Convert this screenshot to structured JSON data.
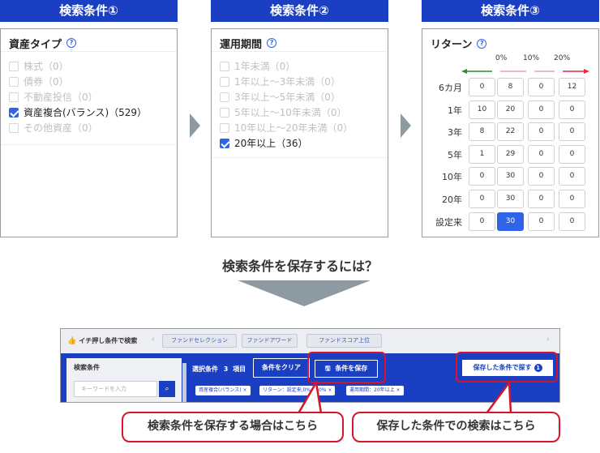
{
  "panels": {
    "p1": {
      "header": "検索条件①",
      "title": "資産タイプ",
      "items": [
        {
          "label": "株式（0）",
          "checked": false
        },
        {
          "label": "債券（0）",
          "checked": false
        },
        {
          "label": "不動産投信（0）",
          "checked": false
        },
        {
          "label": "資産複合(バランス)（529）",
          "checked": true
        },
        {
          "label": "その他資産（0）",
          "checked": false
        }
      ]
    },
    "p2": {
      "header": "検索条件②",
      "title": "運用期間",
      "items": [
        {
          "label": "1年未満（0）",
          "checked": false
        },
        {
          "label": "1年以上～3年未満（0）",
          "checked": false
        },
        {
          "label": "3年以上～5年未満（0）",
          "checked": false
        },
        {
          "label": "5年以上～10年未満（0）",
          "checked": false
        },
        {
          "label": "10年以上～20年未満（0）",
          "checked": false
        },
        {
          "label": "20年以上（36）",
          "checked": true
        }
      ]
    },
    "p3": {
      "header": "検索条件③",
      "title": "リターン",
      "axis": [
        "0%",
        "10%",
        "20%"
      ],
      "rows": [
        {
          "label": "6カ月",
          "cells": [
            "0",
            "8",
            "0",
            "12"
          ]
        },
        {
          "label": "1年",
          "cells": [
            "10",
            "20",
            "0",
            "0"
          ]
        },
        {
          "label": "3年",
          "cells": [
            "8",
            "22",
            "0",
            "0"
          ]
        },
        {
          "label": "5年",
          "cells": [
            "1",
            "29",
            "0",
            "0"
          ]
        },
        {
          "label": "10年",
          "cells": [
            "0",
            "30",
            "0",
            "0"
          ]
        },
        {
          "label": "20年",
          "cells": [
            "0",
            "30",
            "0",
            "0"
          ]
        },
        {
          "label": "設定来",
          "cells": [
            "0",
            "30",
            "0",
            "0"
          ]
        }
      ],
      "active": {
        "row": 6,
        "col": 1
      }
    }
  },
  "question": "検索条件を保存するには？",
  "mock": {
    "top_title": "イチ押し条件で検索",
    "tabs": [
      "ファンドセレクション",
      "ファンドアワード",
      "ファンドスコア上位"
    ],
    "sidebar_title": "検索条件",
    "search_placeholder": "キーワードを入力",
    "selected_label": "選択条件",
    "selected_count": "3",
    "selected_unit": "項目",
    "clear_button": "条件をクリア",
    "save_button": "条件を保存",
    "saved_button": "保存した条件で探す",
    "saved_badge": "1",
    "chips": [
      "資産複合(バランス)",
      "リターン：設定来,0%～10%",
      "運用期間：20年以上"
    ]
  },
  "callouts": {
    "left": "検索条件を保存する場合はこちら",
    "right": "保存した条件での検索はこちら"
  },
  "colors": {
    "brand": "#1a3fc2",
    "accent": "#2f63e8",
    "highlight": "#d7152a",
    "arrow_gray": "#8e9aa2"
  }
}
